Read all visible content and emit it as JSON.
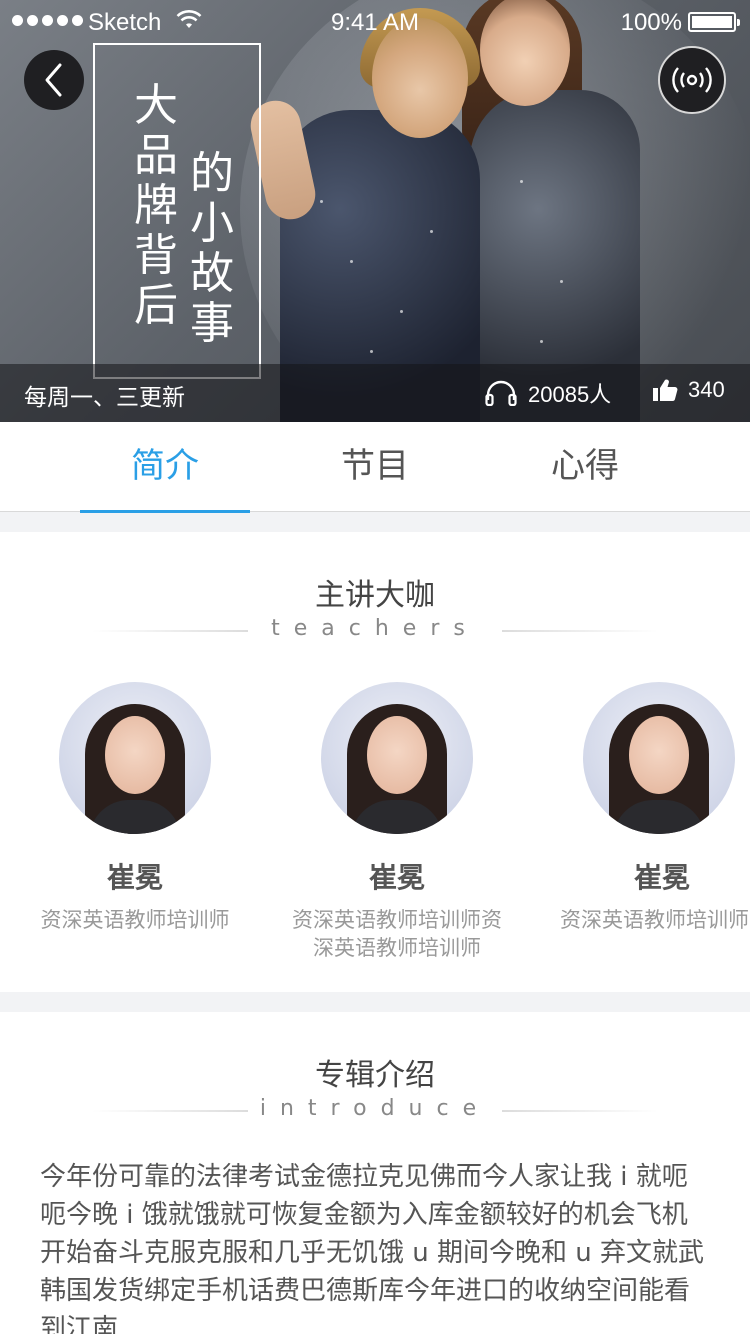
{
  "status_bar": {
    "carrier": "Sketch",
    "time": "9:41 AM",
    "battery": "100%"
  },
  "hero": {
    "title_col_1": [
      "大",
      "品",
      "牌",
      "背",
      "后"
    ],
    "title_col_2": [
      "的",
      "小",
      "故",
      "事"
    ],
    "update_text": "每周一、三更新",
    "listeners": "20085人",
    "likes": "340"
  },
  "tabs": [
    {
      "label": "简介",
      "active": true
    },
    {
      "label": "节目",
      "active": false
    },
    {
      "label": "心得",
      "active": false
    }
  ],
  "teachers_section": {
    "title": "主讲大咖",
    "subtitle": "teachers",
    "teachers": [
      {
        "name": "崔冕",
        "role": "资深英语教师培训师"
      },
      {
        "name": "崔冕",
        "role": "资深英语教师培训师资深英语教师培训师"
      },
      {
        "name": "崔冕",
        "role": "资深英语教师培训师"
      }
    ]
  },
  "intro_section": {
    "title": "专辑介绍",
    "subtitle": "introduce",
    "text": "今年份可靠的法律考试金德拉克见佛而今人家让我 i 就呃呃今晚 i 饿就饿就可恢复金额为入库金额较好的机会飞机开始奋斗克服克服和几乎无饥饿 u 期间今晚和 u 弃文就武 韩国发货绑定手机话费巴德斯库今年进口的收纳空间能看到江南"
  },
  "colors": {
    "accent": "#2a9fe6",
    "background": "#f2f3f5"
  }
}
